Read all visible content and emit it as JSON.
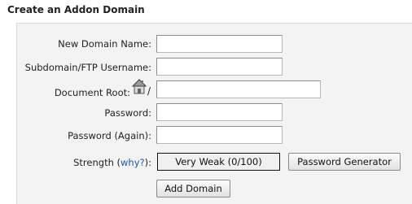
{
  "heading": "Create an Addon Domain",
  "form": {
    "new_domain_label": "New Domain Name:",
    "new_domain_value": "",
    "subdomain_label": "Subdomain/FTP Username:",
    "subdomain_value": "",
    "docroot_label": "Document Root:",
    "docroot_icon": "home-icon",
    "docroot_separator": "/",
    "docroot_value": "",
    "password_label": "Password:",
    "password_value": "",
    "password_again_label": "Password (Again):",
    "password_again_value": "",
    "strength_label_prefix": "Strength (",
    "strength_link": "why?",
    "strength_label_suffix": "):",
    "strength_value": "Very Weak (0/100)",
    "strength_score": 0,
    "password_generator_label": "Password Generator",
    "submit_label": "Add Domain"
  },
  "colors": {
    "link": "#1a5a96",
    "panel_background": "#f3f3f3"
  }
}
